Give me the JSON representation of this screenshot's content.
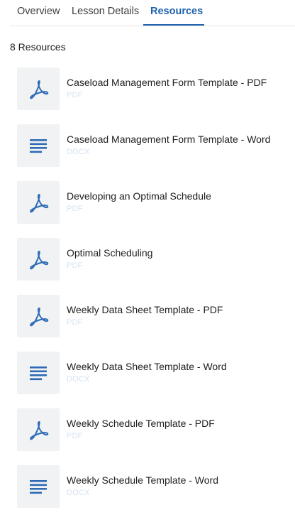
{
  "tabs": [
    {
      "label": "Overview"
    },
    {
      "label": "Lesson Details"
    },
    {
      "label": "Resources",
      "active": true
    }
  ],
  "resources_count": "8 Resources",
  "colors": {
    "accent": "#1f63ad",
    "icon": "#2e6bb5",
    "thumb_bg": "#f1f2f4",
    "type_text": "#d4e2f1"
  },
  "resources": [
    {
      "title": "Caseload Management Form Template - PDF",
      "type": "PDF",
      "icon": "pdf-icon"
    },
    {
      "title": "Caseload Management Form Template - Word",
      "type": "DOCX",
      "icon": "document-lines-icon"
    },
    {
      "title": "Developing an Optimal Schedule",
      "type": "PDF",
      "icon": "pdf-icon"
    },
    {
      "title": "Optimal Scheduling",
      "type": "PDF",
      "icon": "pdf-icon"
    },
    {
      "title": "Weekly Data Sheet Template - PDF",
      "type": "PDF",
      "icon": "pdf-icon"
    },
    {
      "title": "Weekly Data Sheet Template - Word",
      "type": "DOCX",
      "icon": "document-lines-icon"
    },
    {
      "title": "Weekly Schedule Template - PDF",
      "type": "PDF",
      "icon": "pdf-icon"
    },
    {
      "title": "Weekly Schedule Template - Word",
      "type": "DOCX",
      "icon": "document-lines-icon"
    }
  ]
}
